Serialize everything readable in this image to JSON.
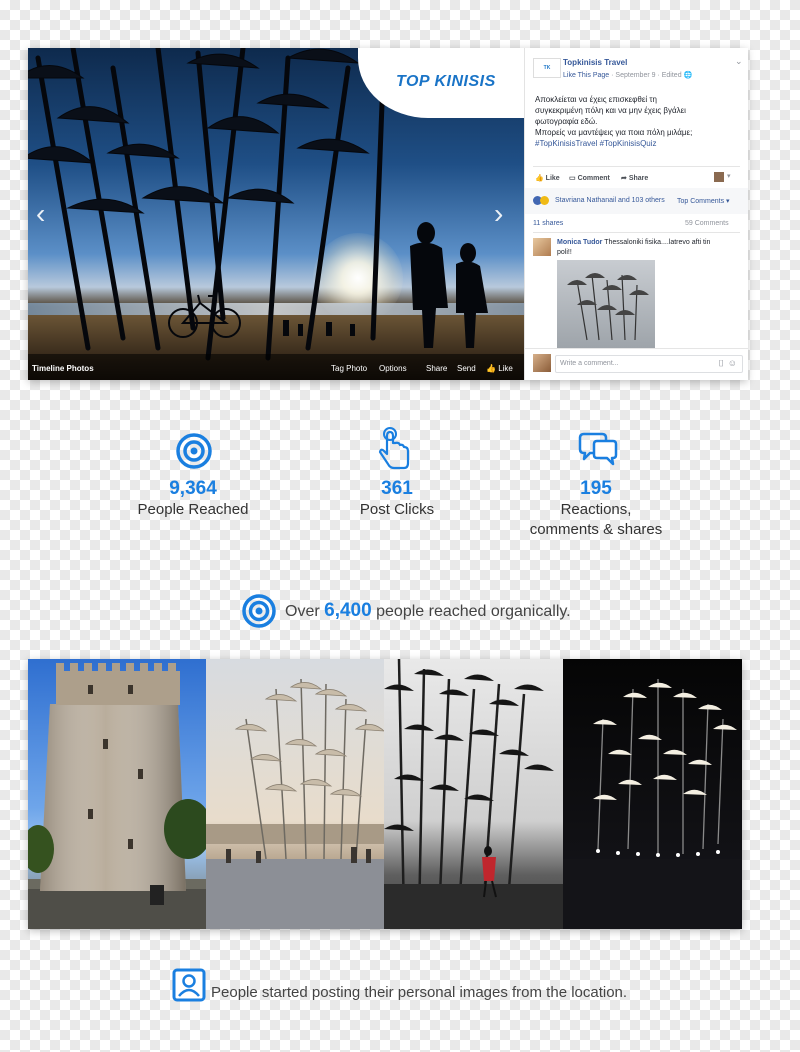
{
  "post": {
    "photo_label": "Timeline Photos",
    "photo_actions": [
      "Tag Photo",
      "Options",
      "Share",
      "Send",
      "Like"
    ],
    "logo_text": "TOP KINISIS",
    "page_name": "Topkinisis Travel",
    "like_page": "Like This Page",
    "date": "September 9",
    "edited": "Edited",
    "text_lines": [
      "Αποκλείεται να έχεις επισκεφθεί τη",
      "συγκεκριμένη πόλη και να μην έχεις βγάλει",
      "φωτογραφία εδώ.",
      "Μπορείς να μαντέψεις για ποια πόλη μιλάμε;"
    ],
    "hashtags": "#TopKinisisTravel #TopKinisisQuiz",
    "actions": {
      "like": "Like",
      "comment": "Comment",
      "share": "Share"
    },
    "reactions_text": "Stavriana Nathanail and 103 others",
    "top_comments": "Top Comments",
    "shares": "11 shares",
    "comments_count": "59 Comments",
    "comment_author": "Monica Tudor",
    "comment_text_1": "Thessaloniki fisika....latrevo afti tin",
    "comment_text_2": "poli!!",
    "write_placeholder": "Write a comment..."
  },
  "stats": [
    {
      "icon": "target-icon",
      "value": "9,364",
      "label": "People Reached"
    },
    {
      "icon": "click-icon",
      "value": "361",
      "label": "Post Clicks"
    },
    {
      "icon": "chat-bubbles-icon",
      "value": "195",
      "label": "Reactions, comments & shares"
    }
  ],
  "organic": {
    "prefix": "Over",
    "value": "6,400",
    "suffix": "people reached organically."
  },
  "footer_text": "People started posting their personal images from the location.",
  "colors": {
    "accent": "#1a7fe0",
    "facebook": "#365899"
  }
}
